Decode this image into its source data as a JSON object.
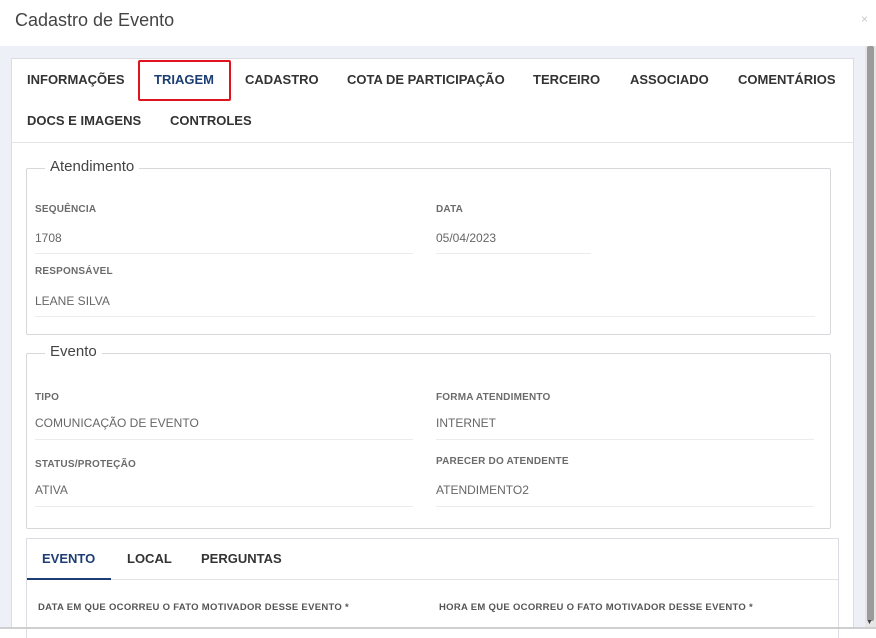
{
  "modal": {
    "title": "Cadastro de Evento",
    "close_label": "×"
  },
  "tabs": [
    {
      "label": "INFORMAÇÕES"
    },
    {
      "label": "TRIAGEM"
    },
    {
      "label": "CADASTRO"
    },
    {
      "label": "COTA DE PARTICIPAÇÃO"
    },
    {
      "label": "TERCEIRO"
    },
    {
      "label": "ASSOCIADO"
    },
    {
      "label": "COMENTÁRIOS"
    },
    {
      "label": "DOCS E IMAGENS"
    },
    {
      "label": "CONTROLES"
    }
  ],
  "active_tab": "TRIAGEM",
  "atendimento": {
    "legend": "Atendimento",
    "sequencia_label": "SEQUÊNCIA",
    "sequencia_value": "1708",
    "data_label": "DATA",
    "data_value": "05/04/2023",
    "responsavel_label": "RESPONSÁVEL",
    "responsavel_value": "LEANE SILVA"
  },
  "evento": {
    "legend": "Evento",
    "tipo_label": "TIPO",
    "tipo_value": "COMUNICAÇÃO DE EVENTO",
    "forma_label": "FORMA ATENDIMENTO",
    "forma_value": "INTERNET",
    "status_label": "STATUS/PROTEÇÃO",
    "status_value": "ATIVA",
    "parecer_label": "PARECER DO ATENDENTE",
    "parecer_value": "ATENDIMENTO2"
  },
  "subtabs": [
    {
      "label": "EVENTO"
    },
    {
      "label": "LOCAL"
    },
    {
      "label": "PERGUNTAS"
    }
  ],
  "active_subtab": "EVENTO",
  "questions": {
    "data_label": "DATA EM QUE OCORREU O FATO MOTIVADOR DESSE EVENTO *",
    "hora_label": "HORA EM QUE OCORREU O FATO MOTIVADOR DESSE EVENTO *"
  },
  "colors": {
    "active_tab": "#1d3e74",
    "highlight": "#e0141e",
    "modal_bg": "#eef0f7"
  }
}
